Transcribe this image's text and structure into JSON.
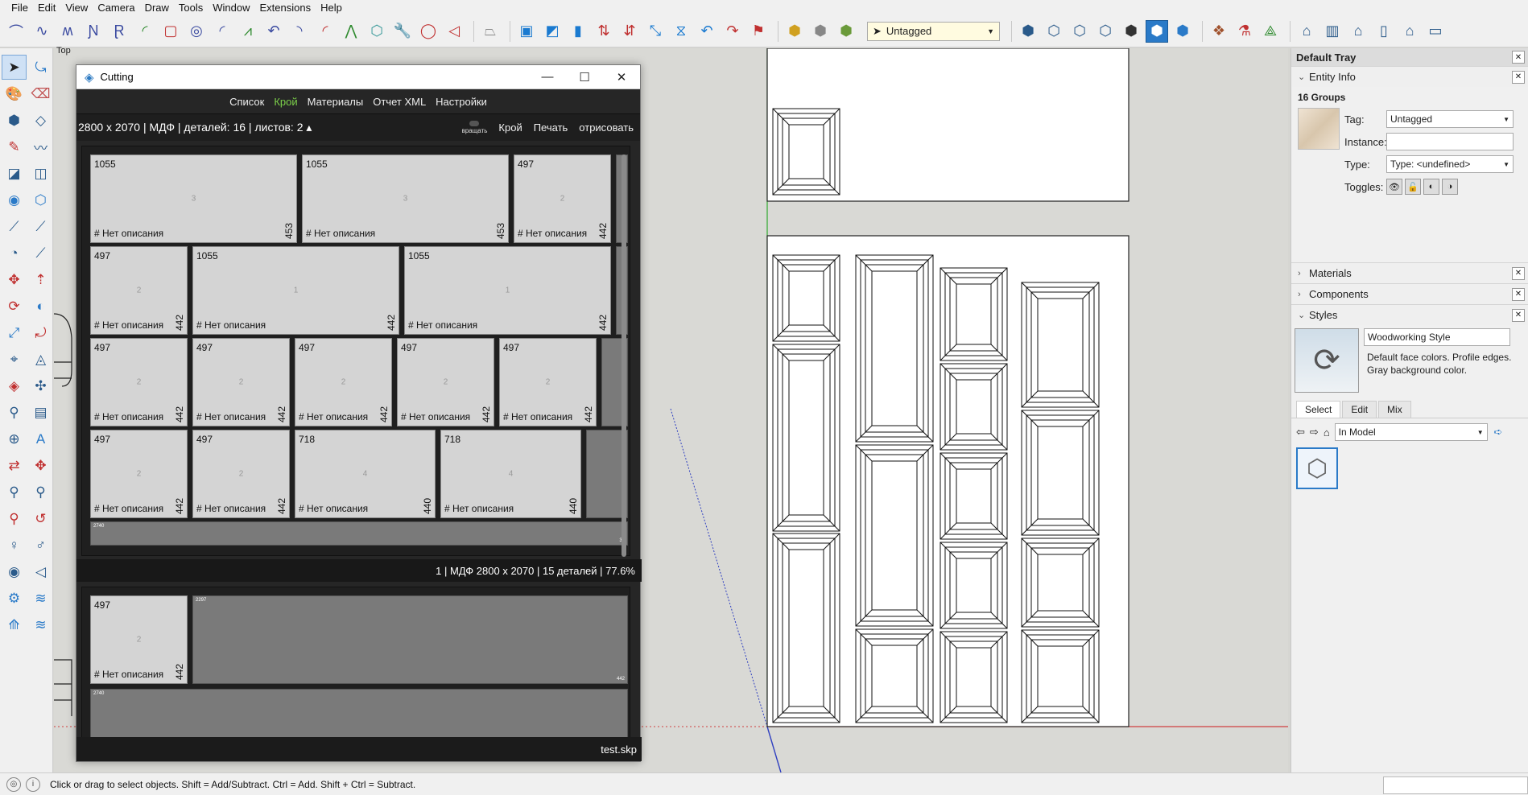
{
  "menu": [
    "File",
    "Edit",
    "View",
    "Camera",
    "Draw",
    "Tools",
    "Window",
    "Extensions",
    "Help"
  ],
  "toolbar": {
    "tag_value": "Untagged",
    "icons_group1": [
      "line-icon",
      "freehand-icon",
      "curve-icon",
      "dimension-icon",
      "arc-icon",
      "rectangle-icon",
      "circle-icon",
      "arc2-icon",
      "line2-icon",
      "arc3-icon",
      "arc4-icon",
      "line3-icon",
      "polygon-icon",
      "wrench-icon",
      "lasso-icon",
      "shape-icon"
    ],
    "icons_group2": [
      "eraser-icon",
      "component-icon",
      "select-icon",
      "push-icon",
      "arrows-icon",
      "scale-icon",
      "flip-icon",
      "rotate-icon",
      "undo-icon",
      "redo-icon"
    ],
    "icons_group3": [
      "box-yellow-icon",
      "box-gray-icon",
      "box-green-icon"
    ],
    "icons_group4": [
      "iso-icon",
      "top-icon",
      "front-icon",
      "right-icon",
      "back-icon",
      "left-icon",
      "shaded-icon",
      "xray-icon",
      "hidden-icon",
      "wire-icon",
      "style-icon",
      "paint-icon",
      "warehouse-icon",
      "sandbox-icon"
    ]
  },
  "left_tools": [
    "select-tool",
    "lasso-tool",
    "paint-tool",
    "eraser-tool",
    "component-tool",
    "tag-tool",
    "pencil-tool",
    "freehand-tool",
    "rect-tool",
    "rotate-rect-tool",
    "circle-tool",
    "polygon-tool",
    "arc-tool",
    "pie-tool",
    "arc3-tool",
    "arc2-tool",
    "move-tool",
    "push-tool",
    "rotate-tool",
    "follow-tool",
    "scale-tool",
    "offset-tool",
    "tape-tool",
    "text-tool",
    "protractor-tool",
    "axes-tool",
    "dimension-tool",
    "3dtext-tool",
    "section-tool",
    "walk-tool",
    "orbit-tool",
    "pan-tool",
    "zoom-tool",
    "zoomwin-tool",
    "zoomext-tool",
    "previous-tool",
    "position-tool",
    "lookaround-tool",
    "eye-tool",
    "walk2-tool",
    "sandbox-tool",
    "smoove-tool",
    "stamp-tool",
    "drape-tool"
  ],
  "view_label": "Top",
  "cutting": {
    "title": "Cutting",
    "tabs": [
      {
        "label": "Список",
        "active": false
      },
      {
        "label": "Крой",
        "active": true
      },
      {
        "label": "Материалы",
        "active": false
      },
      {
        "label": "Отчет XML",
        "active": false
      },
      {
        "label": "Настройки",
        "active": false
      }
    ],
    "summary": "2800 x 2070 | МДФ | деталей: 16 | листов: 2 ▴",
    "rotate_label": "вращать",
    "buttons": [
      "Крой",
      "Печать",
      "отрисовать"
    ],
    "no_desc": "# Нет описания",
    "sheet1": {
      "footer": "1 | МДФ 2800 x 2070 | 15 деталей | 77.6%",
      "rows": [
        [
          {
            "w": "1055",
            "n": "3",
            "h": "453"
          },
          {
            "w": "1055",
            "n": "3",
            "h": "453"
          },
          {
            "w": "497",
            "n": "2",
            "h": "442"
          }
        ],
        [
          {
            "w": "497",
            "n": "2",
            "h": "442"
          },
          {
            "w": "1055",
            "n": "1",
            "h": "442"
          },
          {
            "w": "1055",
            "n": "1",
            "h": "442"
          }
        ],
        [
          {
            "w": "497",
            "n": "2",
            "h": "442"
          },
          {
            "w": "497",
            "n": "2",
            "h": "442"
          },
          {
            "w": "497",
            "n": "2",
            "h": "442"
          },
          {
            "w": "497",
            "n": "2",
            "h": "442"
          },
          {
            "w": "497",
            "n": "2",
            "h": "442"
          }
        ],
        [
          {
            "w": "497",
            "n": "2",
            "h": "442"
          },
          {
            "w": "497",
            "n": "2",
            "h": "442"
          },
          {
            "w": "718",
            "n": "4",
            "h": "440"
          },
          {
            "w": "718",
            "n": "4",
            "h": "440"
          }
        ]
      ],
      "waste_labels": [
        "2740",
        "33"
      ]
    },
    "sheet2": {
      "parts": [
        {
          "w": "497",
          "n": "2",
          "h": "442"
        }
      ],
      "waste_labels": [
        "2297",
        "442",
        "2740"
      ]
    },
    "status": "test.skp"
  },
  "tray": {
    "title": "Default Tray",
    "entity_info": {
      "header": "Entity Info",
      "selection": "16 Groups",
      "tag_label": "Tag:",
      "tag_value": "Untagged",
      "instance_label": "Instance:",
      "instance_value": "",
      "type_label": "Type:",
      "type_value": "Type: <undefined>",
      "toggles_label": "Toggles:"
    },
    "panels": [
      "Materials",
      "Components"
    ],
    "styles": {
      "header": "Styles",
      "style_name": "Woodworking Style",
      "description": "Default face colors. Profile edges. Gray background color.",
      "tabs": [
        "Select",
        "Edit",
        "Mix"
      ],
      "library": "In Model"
    }
  },
  "statusbar": {
    "message": "Click or drag to select objects. Shift = Add/Subtract. Ctrl = Add. Shift + Ctrl = Subtract."
  },
  "colors": {
    "accent_green": "#7cd04a",
    "dialog_bg": "#262626",
    "part_fill": "#d4d4d4",
    "waste_fill": "#7a7a7a",
    "axis_red": "#d04040",
    "axis_green": "#2ea82e",
    "axis_blue": "#3040c0"
  }
}
